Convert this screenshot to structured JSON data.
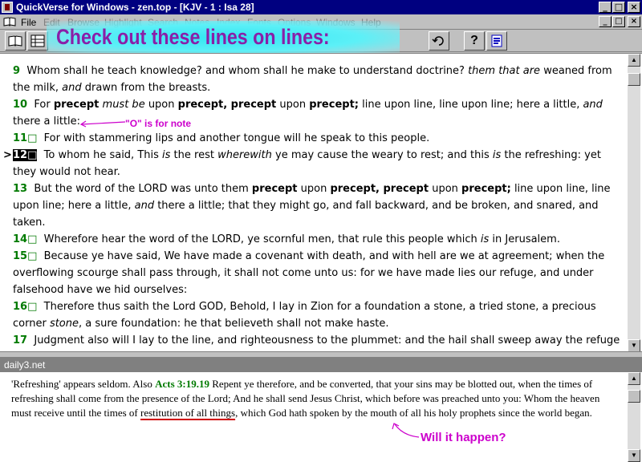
{
  "window": {
    "title": "QuickVerse for Windows - zen.top - [KJV - 1 : Isa 28]",
    "caption_buttons": [
      "_",
      "□",
      "×"
    ]
  },
  "menubar": {
    "items": [
      "File",
      "Edit",
      "Browse",
      "Highlight",
      "Search",
      "Notes",
      "Index",
      "Fonts",
      "Options",
      "Windows",
      "Help"
    ]
  },
  "annotations": {
    "banner": "Check out these lines on lines:",
    "note_label": "\"O\" is for note",
    "ask": "Will it happen?"
  },
  "verses": [
    {
      "num": "9",
      "parts": [
        [
          "",
          "Whom shall he teach knowledge? and whom shall he make to understand doctrine? "
        ],
        [
          "it",
          "them that are"
        ],
        [
          "",
          " weaned from the milk, "
        ],
        [
          "it",
          "and"
        ],
        [
          "",
          " drawn from the breasts."
        ]
      ]
    },
    {
      "num": "10",
      "parts": [
        [
          "",
          "For "
        ],
        [
          "b",
          "precept"
        ],
        [
          "",
          " "
        ],
        [
          "it",
          "must be"
        ],
        [
          "",
          " upon "
        ],
        [
          "b",
          "precept, precept"
        ],
        [
          "",
          " upon "
        ],
        [
          "b",
          "precept;"
        ],
        [
          "",
          " line upon line, line upon line; here a little, "
        ],
        [
          "it",
          "and"
        ],
        [
          "",
          " there a little:"
        ]
      ]
    },
    {
      "num": "11□",
      "parts": [
        [
          "",
          "For with stammering lips and another tongue will he speak to this people."
        ]
      ]
    },
    {
      "num": "12□",
      "selected": true,
      "parts": [
        [
          "",
          "To whom he said, This "
        ],
        [
          "it",
          "is"
        ],
        [
          "",
          " the rest "
        ],
        [
          "it",
          "wherewith"
        ],
        [
          "",
          " ye may cause the weary to rest; and this "
        ],
        [
          "it",
          "is"
        ],
        [
          "",
          " the refreshing: yet they would not hear."
        ]
      ]
    },
    {
      "num": "13",
      "parts": [
        [
          "",
          "But the word of the LORD was unto them "
        ],
        [
          "b",
          "precept"
        ],
        [
          "",
          " upon "
        ],
        [
          "b",
          "precept, precept"
        ],
        [
          "",
          " upon "
        ],
        [
          "b",
          "precept;"
        ],
        [
          "",
          " line upon line, line upon line; here a little, "
        ],
        [
          "it",
          "and"
        ],
        [
          "",
          " there a little; that they might go, and fall backward, and be broken, and snared, and taken."
        ]
      ]
    },
    {
      "num": "14□",
      "parts": [
        [
          "",
          "Wherefore hear the word of the LORD, ye scornful men, that rule this people which "
        ],
        [
          "it",
          "is"
        ],
        [
          "",
          " in Jerusalem."
        ]
      ]
    },
    {
      "num": "15□",
      "parts": [
        [
          "",
          "Because ye have said, We have made a covenant with death, and with hell are we at agreement; when the overflowing scourge shall pass through, it shall not come unto us: for we have made lies our refuge, and under falsehood have we hid ourselves:"
        ]
      ]
    },
    {
      "num": "16□",
      "parts": [
        [
          "",
          "Therefore thus saith the Lord GOD, Behold, I lay in Zion for a foundation a stone, a tried stone, a precious corner "
        ],
        [
          "it",
          "stone"
        ],
        [
          "",
          ", a sure foundation: he that believeth shall not make haste."
        ]
      ]
    },
    {
      "num": "17",
      "parts": [
        [
          "",
          "Judgment also will I lay to the line, and righteousness to the plummet: and the hail shall sweep away the refuge of lies, and the waters shall overflow the hiding place."
        ]
      ]
    }
  ],
  "pointer": ">",
  "notes_pane": {
    "title": "daily3.net",
    "text_before": "'Refreshing' appears seldom. Also ",
    "ref": "Acts 3:19.19",
    "text_middle": " Repent ye therefore, and be converted, that your sins may be blotted out, when the times of refreshing shall come from the presence of the Lord; And he shall send Jesus Christ, which before was preached unto you: Whom the heaven must receive until the times of ",
    "underlined": "restitution of all things",
    "text_after": ", which God hath spoken by the mouth of all his holy prophets since the world began."
  },
  "colors": {
    "titlebar": "#000080",
    "verse_number": "#007a00",
    "annotation": "#cc00cc",
    "banner_text": "#8a1fa8",
    "banner_bg": "#33e6f2",
    "underline": "#d00000"
  }
}
